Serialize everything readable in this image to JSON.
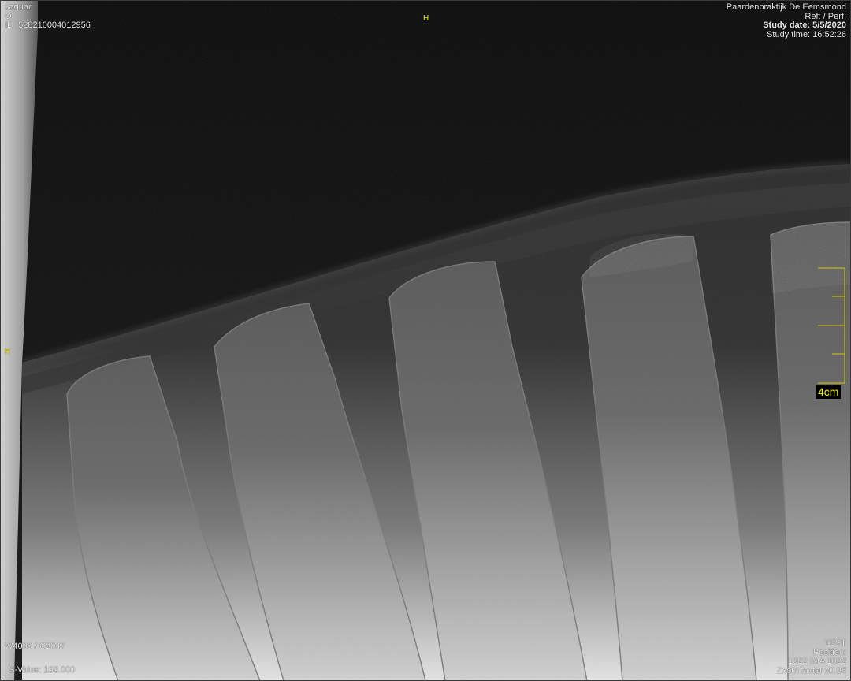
{
  "patient": {
    "name": "Jaguar",
    "sex": "O",
    "id": "ID: 528210004012956"
  },
  "study": {
    "institution": "Paardenpraktijk De Eemsmond",
    "ref": "Ref:  / Perf:",
    "date": "Study date: 5/5/2020",
    "time": "Study time: 16:52:26"
  },
  "orientation": {
    "top": "H",
    "left": "R"
  },
  "window": {
    "level": "W4095 / C2047",
    "s_value": "S-Value: 163.000"
  },
  "image_info": {
    "label": "TEST",
    "position": "Position:",
    "ima": "1022 IMA 1022",
    "zoom": "Zoom factor x0.96"
  },
  "scale_bar": {
    "label": "4cm",
    "color": "#f0f000"
  },
  "colors": {
    "overlay_text": "#e6e6e6",
    "orientation_marker": "#f0f000",
    "background": "#000000"
  }
}
